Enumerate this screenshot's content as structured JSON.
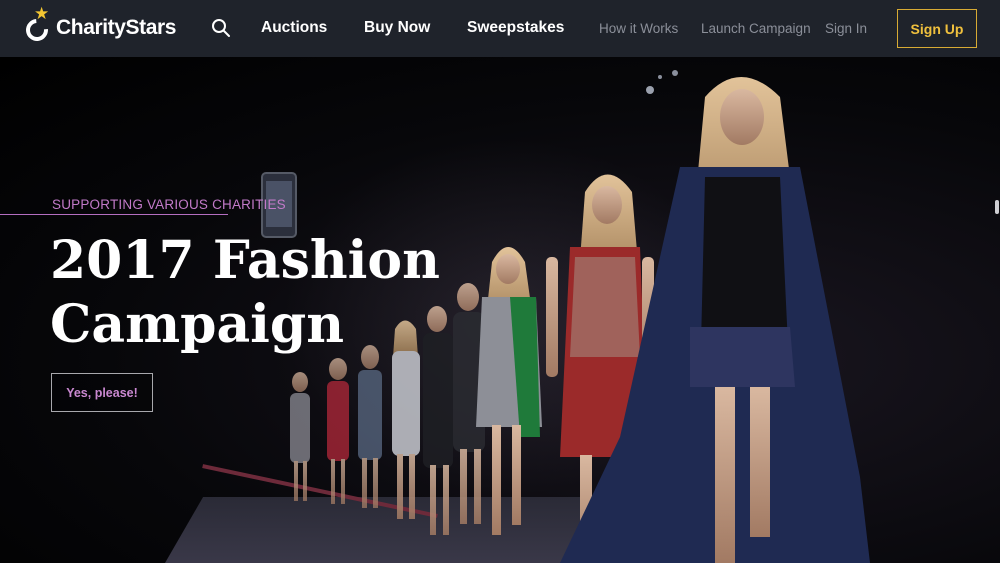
{
  "brand": {
    "name": "CharityStars",
    "star_color": "#f3c632"
  },
  "nav": {
    "primary": [
      {
        "label": "Auctions"
      },
      {
        "label": "Buy Now"
      },
      {
        "label": "Sweepstakes"
      }
    ],
    "secondary": [
      {
        "label": "How it Works"
      },
      {
        "label": "Launch Campaign"
      },
      {
        "label": "Sign In"
      }
    ],
    "signup_label": "Sign Up",
    "search_icon": "search-icon"
  },
  "hero": {
    "eyebrow": "SUPPORTING VARIOUS CHARITIES",
    "title_line1": "2017 Fashion",
    "title_line2": "Campaign",
    "cta_label": "Yes, please!"
  },
  "colors": {
    "nav_bg": "#1f232b",
    "accent_gold": "#f0c03d",
    "accent_purple": "#c27ac9"
  }
}
